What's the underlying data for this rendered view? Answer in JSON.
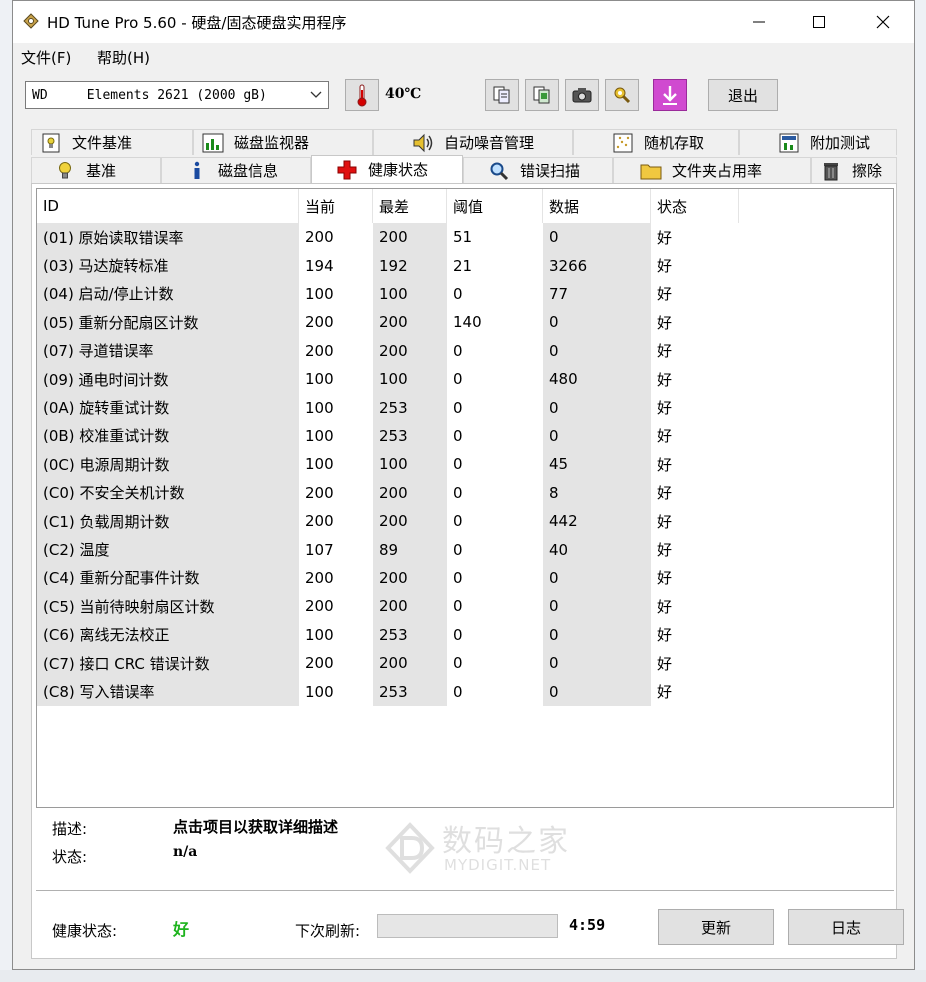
{
  "window": {
    "title": "HD Tune Pro 5.60 - 硬盘/固态硬盘实用程序"
  },
  "menu": [
    {
      "label": "文件(F)"
    },
    {
      "label": "帮助(H)"
    }
  ],
  "toolbar": {
    "drive": "WD     Elements 2621 (2000 gB)",
    "temperature": "40℃",
    "exit_label": "退出"
  },
  "tabs_top": [
    {
      "label": "文件基准",
      "icon": "file-benchmark-icon"
    },
    {
      "label": "磁盘监视器",
      "icon": "disk-monitor-icon"
    },
    {
      "label": "自动噪音管理",
      "icon": "speaker-icon"
    },
    {
      "label": "随机存取",
      "icon": "random-access-icon"
    },
    {
      "label": "附加测试",
      "icon": "extra-tests-icon"
    }
  ],
  "tabs_bottom": [
    {
      "label": "基准",
      "icon": "lightbulb-icon"
    },
    {
      "label": "磁盘信息",
      "icon": "info-icon"
    },
    {
      "label": "健康状态",
      "icon": "red-cross-icon",
      "active": true
    },
    {
      "label": "错误扫描",
      "icon": "magnifier-icon"
    },
    {
      "label": "文件夹占用率",
      "icon": "folder-icon"
    },
    {
      "label": "擦除",
      "icon": "trash-icon"
    }
  ],
  "table": {
    "headers": [
      "ID",
      "当前",
      "最差",
      "阈值",
      "数据",
      "状态"
    ],
    "rows": [
      [
        "(01) 原始读取错误率",
        "200",
        "200",
        "51",
        "0",
        "好"
      ],
      [
        "(03) 马达旋转标准",
        "194",
        "192",
        "21",
        "3266",
        "好"
      ],
      [
        "(04) 启动/停止计数",
        "100",
        "100",
        "0",
        "77",
        "好"
      ],
      [
        "(05) 重新分配扇区计数",
        "200",
        "200",
        "140",
        "0",
        "好"
      ],
      [
        "(07) 寻道错误率",
        "200",
        "200",
        "0",
        "0",
        "好"
      ],
      [
        "(09) 通电时间计数",
        "100",
        "100",
        "0",
        "480",
        "好"
      ],
      [
        "(0A) 旋转重试计数",
        "100",
        "253",
        "0",
        "0",
        "好"
      ],
      [
        "(0B) 校准重试计数",
        "100",
        "253",
        "0",
        "0",
        "好"
      ],
      [
        "(0C) 电源周期计数",
        "100",
        "100",
        "0",
        "45",
        "好"
      ],
      [
        "(C0) 不安全关机计数",
        "200",
        "200",
        "0",
        "8",
        "好"
      ],
      [
        "(C1) 负载周期计数",
        "200",
        "200",
        "0",
        "442",
        "好"
      ],
      [
        "(C2) 温度",
        "107",
        "89",
        "0",
        "40",
        "好"
      ],
      [
        "(C4) 重新分配事件计数",
        "200",
        "200",
        "0",
        "0",
        "好"
      ],
      [
        "(C5) 当前待映射扇区计数",
        "200",
        "200",
        "0",
        "0",
        "好"
      ],
      [
        "(C6) 离线无法校正",
        "100",
        "253",
        "0",
        "0",
        "好"
      ],
      [
        "(C7) 接口 CRC 错误计数",
        "200",
        "200",
        "0",
        "0",
        "好"
      ],
      [
        "(C8) 写入错误率",
        "100",
        "253",
        "0",
        "0",
        "好"
      ]
    ]
  },
  "details": {
    "desc_label": "描述:",
    "desc_value": "点击项目以获取详细描述",
    "status_label": "状态:",
    "status_value": "n/a"
  },
  "footer": {
    "health_label": "健康状态:",
    "health_value": "好",
    "health_color": "#1db31d",
    "refresh_label": "下次刷新:",
    "refresh_time": "4:59",
    "update_label": "更新",
    "log_label": "日志"
  },
  "watermark": {
    "name": "数码之家",
    "domain": "MYDIGIT.NET"
  }
}
